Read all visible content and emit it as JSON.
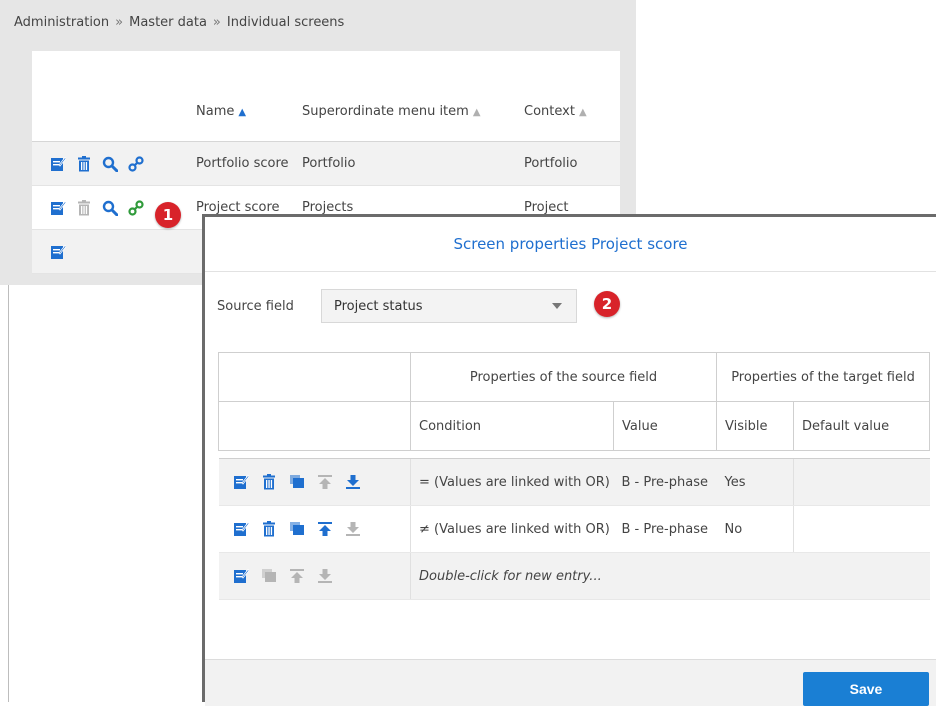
{
  "breadcrumb": [
    "Administration",
    "Master data",
    "Individual screens"
  ],
  "breadcrumb_separator": "»",
  "screens_table": {
    "columns": [
      "Name",
      "Superordinate menu item",
      "Context"
    ],
    "rows": [
      {
        "name": "Portfolio score",
        "menu_item": "Portfolio",
        "context": "Portfolio"
      },
      {
        "name": "Project score",
        "menu_item": "Projects",
        "context": "Project"
      }
    ]
  },
  "badges": {
    "one": "1",
    "two": "2"
  },
  "dialog": {
    "title": "Screen properties Project score",
    "source_field_label": "Source field",
    "source_field_value": "Project status",
    "group_source": "Properties of the source field",
    "group_target": "Properties of the target field",
    "col_condition": "Condition",
    "col_value": "Value",
    "col_visible": "Visible",
    "col_default": "Default value",
    "rows": [
      {
        "condition": "= (Values are linked with OR)",
        "value": "B - Pre-phase",
        "visible": "Yes",
        "default": ""
      },
      {
        "condition": "≠ (Values are linked with OR)",
        "value": "B - Pre-phase",
        "visible": "No",
        "default": ""
      }
    ],
    "new_entry_hint": "Double-click for new entry...",
    "save_label": "Save"
  },
  "colors": {
    "accent": "#1f6fcf",
    "badge": "#d8232a",
    "save": "#1a7fd4",
    "link_green": "#2f9a3a"
  }
}
